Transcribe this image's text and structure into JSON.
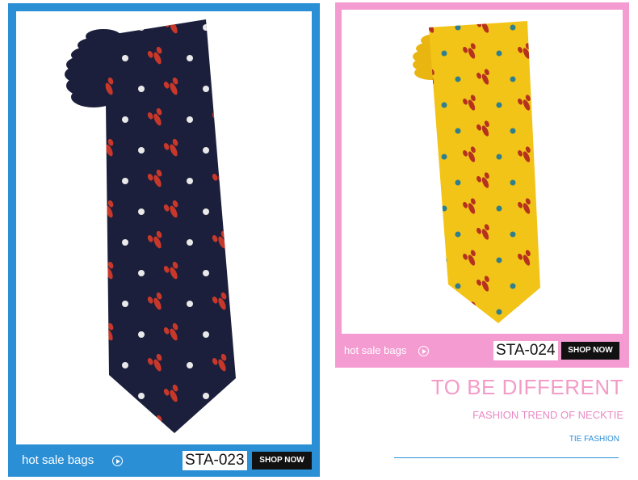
{
  "products": [
    {
      "promo_label": "hot sale bags",
      "code": "STA-023",
      "shop_label": "SHOP NOW",
      "colors": {
        "frame": "#2b8fd6",
        "tie": "#1b1f3c",
        "motif_primary": "#c8382a",
        "motif_secondary": "#e9e9e9"
      }
    },
    {
      "promo_label": "hot sale bags",
      "code": "STA-024",
      "shop_label": "SHOP NOW",
      "colors": {
        "frame": "#f49bd2",
        "tie": "#f2c418",
        "motif_primary": "#b5321f",
        "motif_secondary": "#2f7f8f"
      }
    }
  ],
  "tagline": {
    "headline": "TO BE DIFFERENT",
    "subhead": "FASHION TREND OF NECKTIE",
    "small": "TIE FASHION"
  },
  "icons": [
    "play-circle-icon"
  ]
}
